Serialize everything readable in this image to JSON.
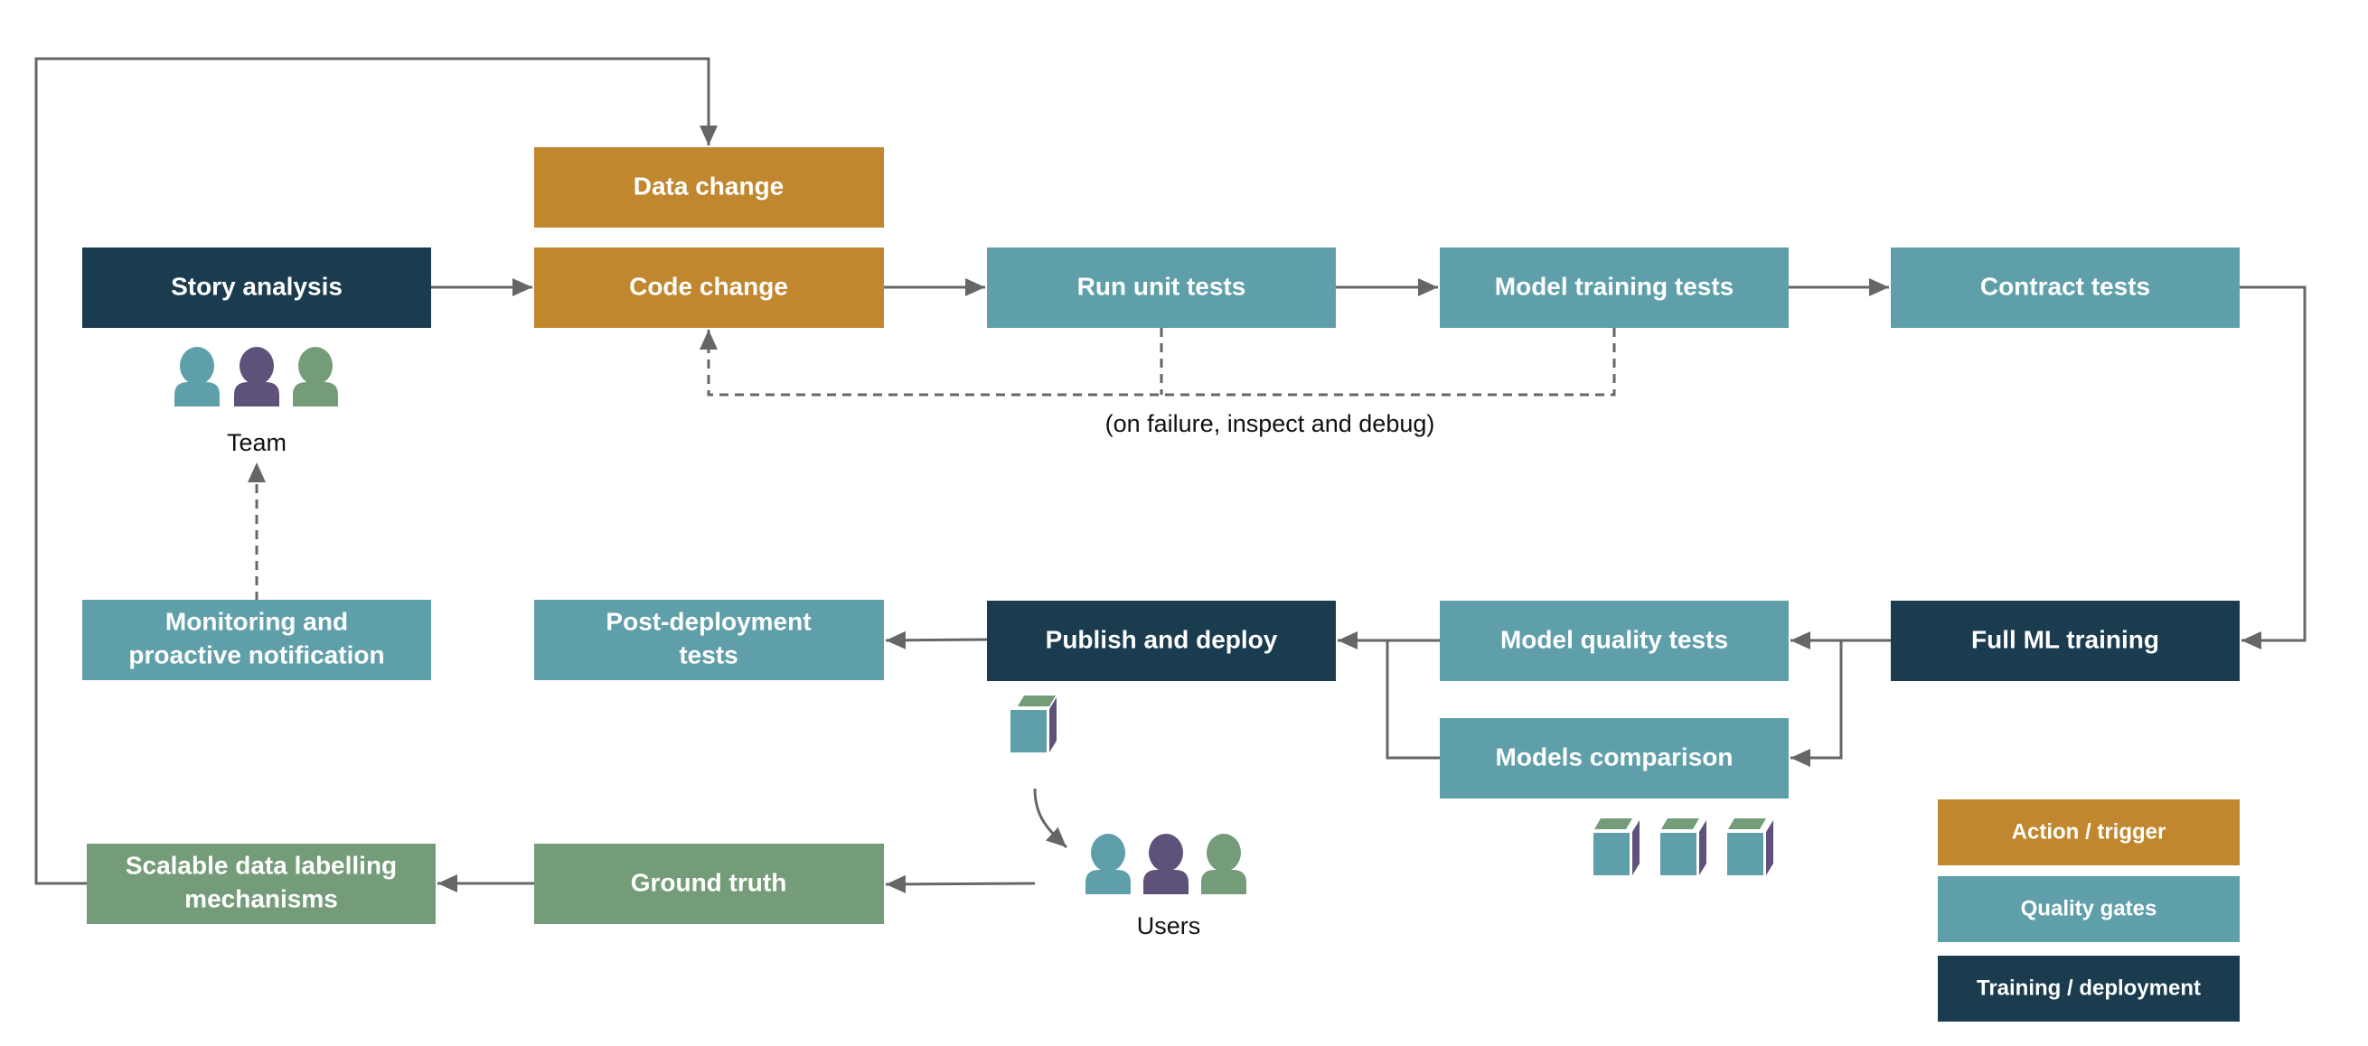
{
  "colors": {
    "action": "#C1872F",
    "quality": "#5F9FAA",
    "training": "#1A3C4E",
    "green": "#759C78",
    "purple": "#5F527A",
    "line": "#666666"
  },
  "nodes": {
    "data_change": "Data change",
    "story_analysis": "Story analysis",
    "code_change": "Code change",
    "run_unit_tests": "Run unit tests",
    "model_training_tests": "Model training tests",
    "contract_tests": "Contract tests",
    "monitoring": [
      "Monitoring and",
      "proactive notification"
    ],
    "post_deployment": [
      "Post-deployment",
      "tests"
    ],
    "publish_deploy": "Publish and deploy",
    "model_quality_tests": "Model quality tests",
    "full_ml_training": "Full ML training",
    "models_comparison": "Models comparison",
    "scalable_labelling": [
      "Scalable data labelling",
      "mechanisms"
    ],
    "ground_truth": "Ground truth"
  },
  "labels": {
    "team": "Team",
    "users": "Users",
    "failure_note": "(on failure, inspect and debug)"
  },
  "legend": [
    {
      "label": "Action / trigger",
      "color": "#C1872F"
    },
    {
      "label": "Quality gates",
      "color": "#5F9FAA"
    },
    {
      "label": "Training / deployment",
      "color": "#1A3C4E"
    }
  ]
}
